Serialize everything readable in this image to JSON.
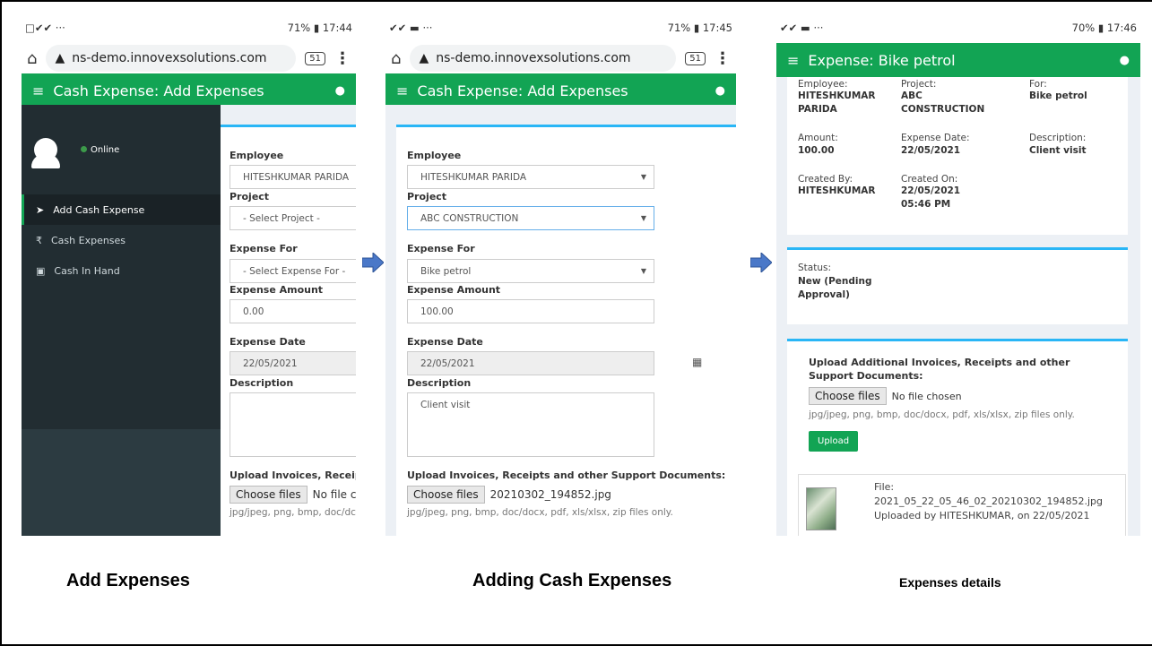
{
  "screen1": {
    "status": {
      "left_icons": "□✔✔ ···",
      "right": "71% ▮ 17:44"
    },
    "url": "ns-demo.innovexsolutions.com",
    "tab_count": "51",
    "appbar_title": "Cash Expense: Add Expenses",
    "sidebar": {
      "status": "Online",
      "items": [
        {
          "label": "Add Cash Expense",
          "icon": "paper-plane-icon"
        },
        {
          "label": "Cash Expenses",
          "icon": "rupee-icon"
        },
        {
          "label": "Cash In Hand",
          "icon": "money-icon"
        }
      ]
    },
    "form": {
      "employee_label": "Employee",
      "employee_value": "HITESHKUMAR PARIDA",
      "project_label": "Project",
      "project_value": "- Select Project -",
      "expense_for_label": "Expense For",
      "expense_for_value": "- Select Expense For -",
      "amount_label": "Expense Amount",
      "amount_value": "0.00",
      "date_label": "Expense Date",
      "date_value": "22/05/2021",
      "description_label": "Description",
      "upload_label": "Upload Invoices, Receipts",
      "choose_label": "Choose files",
      "file_status": "No file cho",
      "hint": "jpg/jpeg, png, bmp, doc/dc"
    }
  },
  "screen2": {
    "status": {
      "left_icons": "✔✔ ▬ ···",
      "right": "71% ▮ 17:45"
    },
    "url": "ns-demo.innovexsolutions.com",
    "tab_count": "51",
    "appbar_title": "Cash Expense: Add Expenses",
    "form": {
      "employee_label": "Employee",
      "employee_value": "HITESHKUMAR PARIDA",
      "project_label": "Project",
      "project_value": "ABC CONSTRUCTION",
      "expense_for_label": "Expense For",
      "expense_for_value": "Bike petrol",
      "amount_label": "Expense Amount",
      "amount_value": "100.00",
      "date_label": "Expense Date",
      "date_value": "22/05/2021",
      "description_label": "Description",
      "description_value": "Client visit",
      "upload_label": "Upload Invoices, Receipts and other Support Documents:",
      "choose_label": "Choose files",
      "file_status": "20210302_194852.jpg",
      "hint": "jpg/jpeg, png, bmp, doc/docx, pdf, xls/xlsx, zip files only."
    }
  },
  "screen3": {
    "status": {
      "left_icons": "✔✔ ▬ ···",
      "right": "70% ▮ 17:46"
    },
    "appbar_title": "Expense: Bike petrol",
    "details": {
      "employee_label": "Employee:",
      "employee_value": "HITESHKUMAR PARIDA",
      "project_label": "Project:",
      "project_value": "ABC CONSTRUCTION",
      "for_label": "For:",
      "for_value": "Bike petrol",
      "amount_label": "Amount:",
      "amount_value": "100.00",
      "date_label": "Expense Date:",
      "date_value": "22/05/2021",
      "description_label": "Description:",
      "description_value": "Client visit",
      "created_by_label": "Created By:",
      "created_by_value": "HITESHKUMAR",
      "created_on_label": "Created On:",
      "created_on_date": "22/05/2021",
      "created_on_time": "05:46 PM"
    },
    "status_card": {
      "label": "Status:",
      "value_line1": "New (Pending",
      "value_line2": "Approval)"
    },
    "upload": {
      "title_line1": "Upload Additional Invoices, Receipts and other",
      "title_line2": "Support Documents:",
      "choose_label": "Choose files",
      "file_status": "No file chosen",
      "hint": "jpg/jpeg, png, bmp, doc/docx, pdf, xls/xlsx, zip files only.",
      "button": "Upload"
    },
    "file": {
      "label": "File:",
      "name": "2021_05_22_05_46_02_20210302_194852.jpg",
      "uploaded": "Uploaded by HITESHKUMAR, on 22/05/2021"
    }
  },
  "captions": [
    "Add Expenses",
    "Adding Cash Expenses",
    "Expenses details"
  ],
  "colors": {
    "appbar": "#12a454",
    "sidebar": "#222d32",
    "card_accent": "#29b6f6",
    "arrow": "#4a78c8"
  }
}
